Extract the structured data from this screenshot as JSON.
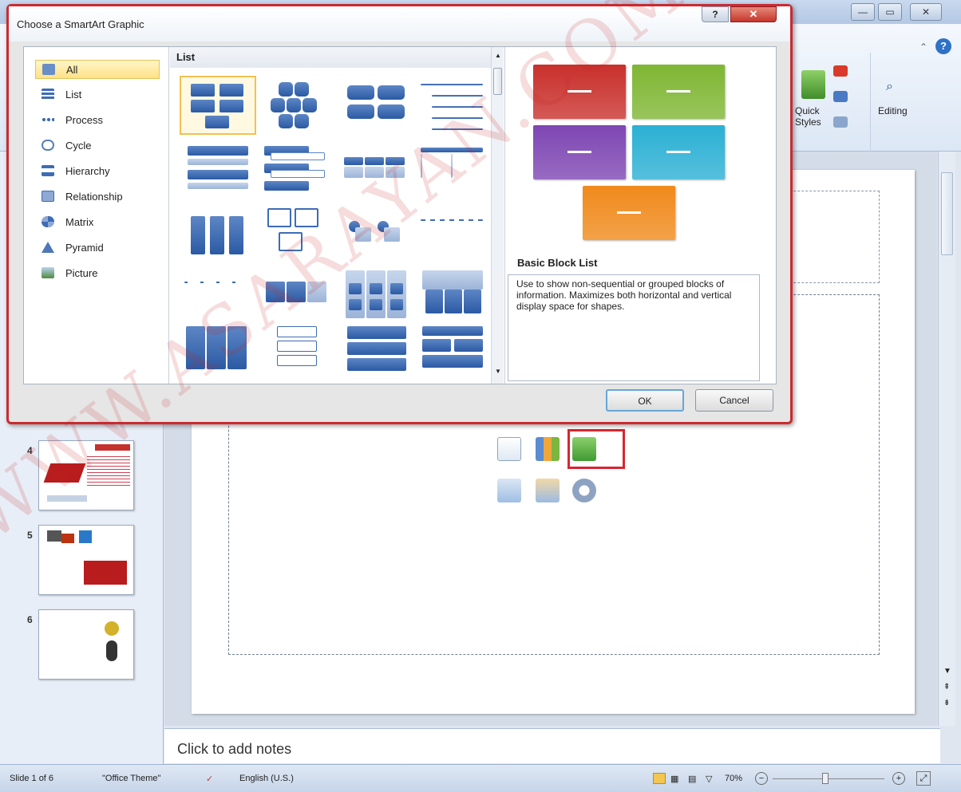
{
  "ribbon": {
    "quick_styles_label": "Quick Styles",
    "editing_label": "Editing"
  },
  "dialog": {
    "title": "Choose a SmartArt Graphic",
    "categories": [
      {
        "label": "All",
        "icon": "all-icon",
        "selected": true
      },
      {
        "label": "List",
        "icon": "list-icon"
      },
      {
        "label": "Process",
        "icon": "process-icon"
      },
      {
        "label": "Cycle",
        "icon": "cycle-icon"
      },
      {
        "label": "Hierarchy",
        "icon": "hierarchy-icon"
      },
      {
        "label": "Relationship",
        "icon": "relationship-icon"
      },
      {
        "label": "Matrix",
        "icon": "matrix-icon"
      },
      {
        "label": "Pyramid",
        "icon": "pyramid-icon"
      },
      {
        "label": "Picture",
        "icon": "picture-icon"
      }
    ],
    "gallery_header": "List",
    "preview_title": "Basic Block List",
    "preview_description": "Use to show non-sequential or grouped blocks of information. Maximizes both horizontal and vertical display space for shapes.",
    "preview_colors": [
      "#c9302c",
      "#7fb633",
      "#7e46b3",
      "#2bb0d4",
      "#f08a1c"
    ],
    "ok_label": "OK",
    "cancel_label": "Cancel"
  },
  "slides": [
    {
      "number": "4"
    },
    {
      "number": "5"
    },
    {
      "number": "6"
    }
  ],
  "notes_placeholder": "Click to add notes",
  "status": {
    "slide_info": "Slide 1 of 6",
    "theme": "\"Office Theme\"",
    "language": "English (U.S.)",
    "zoom": "70%"
  },
  "watermark": "WWW.ASARAYAN.COM"
}
